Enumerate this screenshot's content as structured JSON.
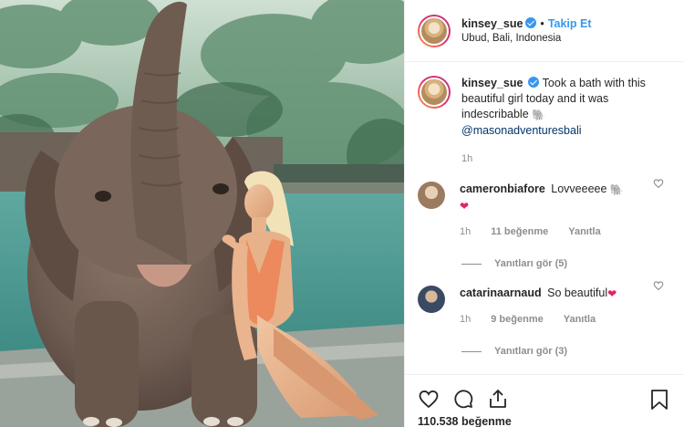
{
  "post": {
    "username": "kinsey_sue",
    "follow_separator": "•",
    "follow_label": "Takip Et",
    "location": "Ubud, Bali, Indonesia",
    "caption": {
      "username": "kinsey_sue",
      "text": "Took a bath with this beautiful girl today and it was indescribable",
      "emoji": "🐘",
      "mention": "@masonadventuresbali",
      "time": "1h"
    },
    "likes": {
      "count": "110.538",
      "label": "beğenme"
    }
  },
  "comments": [
    {
      "username": "cameronbiafore",
      "text": "Lovveeeee",
      "emoji": "🐘",
      "emoji2": "❤",
      "time": "1h",
      "likes": "11 beğenme",
      "reply": "Yanıtla",
      "view_replies": "Yanıtları gör (5)"
    },
    {
      "username": "catarinaarnaud",
      "text": "So beautiful",
      "emoji": "❤",
      "time": "1h",
      "likes": "9 beğenme",
      "reply": "Yanıtla",
      "view_replies": "Yanıtları gör (3)"
    }
  ],
  "icons": {
    "verified": "verified-badge-icon",
    "like": "heart-icon",
    "comment": "comment-icon",
    "share": "share-icon",
    "save": "bookmark-icon"
  },
  "colors": {
    "link": "#3897f0",
    "muted": "#8e8e8e",
    "border": "#efefef"
  }
}
